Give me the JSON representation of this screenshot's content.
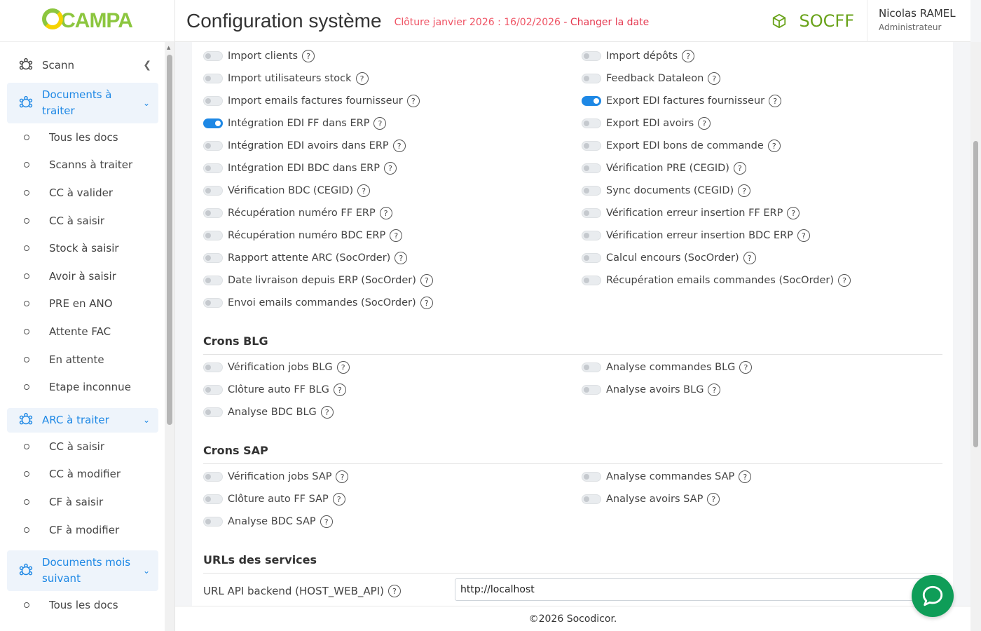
{
  "logo_text": "CAMPA",
  "sidebar": {
    "top_item": "Scann",
    "sections": [
      {
        "label": "Documents à traiter",
        "items": [
          "Tous les docs",
          "Scanns à traiter",
          "CC à valider",
          "CC à saisir",
          "Stock à saisir",
          "Avoir à saisir",
          "PRE en ANO",
          "Attente FAC",
          "En attente",
          "Etape inconnue"
        ]
      },
      {
        "label": "ARC à traiter",
        "items": [
          "CC à saisir",
          "CC à modifier",
          "CF à saisir",
          "CF à modifier"
        ]
      },
      {
        "label": "Documents mois suivant",
        "items": [
          "Tous les docs"
        ]
      }
    ]
  },
  "header": {
    "title": "Configuration système",
    "closure_text": "Clôture janvier 2026 : 16/02/2026",
    "closure_sep": " - ",
    "closure_link": "Changer la date",
    "company": "SOCFF",
    "user_name": "Nicolas RAMEL",
    "user_role": "Administrateur"
  },
  "crons_general": {
    "left": [
      {
        "label": "Import clients",
        "on": false
      },
      {
        "label": "Import utilisateurs stock",
        "on": false
      },
      {
        "label": "Import emails factures fournisseur",
        "on": false
      },
      {
        "label": "Intégration EDI FF dans ERP",
        "on": true
      },
      {
        "label": "Intégration EDI avoirs dans ERP",
        "on": false
      },
      {
        "label": "Intégration EDI BDC dans ERP",
        "on": false
      },
      {
        "label": "Vérification BDC (CEGID)",
        "on": false
      },
      {
        "label": "Récupération numéro FF ERP",
        "on": false
      },
      {
        "label": "Récupération numéro BDC ERP",
        "on": false
      },
      {
        "label": "Rapport attente ARC (SocOrder)",
        "on": false
      },
      {
        "label": "Date livraison depuis ERP (SocOrder)",
        "on": false
      },
      {
        "label": "Envoi emails commandes (SocOrder)",
        "on": false
      }
    ],
    "right": [
      {
        "label": "Import dépôts",
        "on": false
      },
      {
        "label": "Feedback Dataleon",
        "on": false
      },
      {
        "label": "Export EDI factures fournisseur",
        "on": true
      },
      {
        "label": "Export EDI avoirs",
        "on": false
      },
      {
        "label": "Export EDI bons de commande",
        "on": false
      },
      {
        "label": "Vérification PRE (CEGID)",
        "on": false
      },
      {
        "label": "Sync documents (CEGID)",
        "on": false
      },
      {
        "label": "Vérification erreur insertion FF ERP",
        "on": false
      },
      {
        "label": "Vérification erreur insertion BDC ERP",
        "on": false
      },
      {
        "label": "Calcul encours (SocOrder)",
        "on": false
      },
      {
        "label": "Récupération emails commandes (SocOrder)",
        "on": false
      }
    ]
  },
  "crons_blg": {
    "title": "Crons BLG",
    "left": [
      {
        "label": "Vérification jobs BLG",
        "on": false
      },
      {
        "label": "Clôture auto FF BLG",
        "on": false
      },
      {
        "label": "Analyse BDC BLG",
        "on": false
      }
    ],
    "right": [
      {
        "label": "Analyse commandes BLG",
        "on": false
      },
      {
        "label": "Analyse avoirs BLG",
        "on": false
      }
    ]
  },
  "crons_sap": {
    "title": "Crons SAP",
    "left": [
      {
        "label": "Vérification jobs SAP",
        "on": false
      },
      {
        "label": "Clôture auto FF SAP",
        "on": false
      },
      {
        "label": "Analyse BDC SAP",
        "on": false
      }
    ],
    "right": [
      {
        "label": "Analyse commandes SAP",
        "on": false
      },
      {
        "label": "Analyse avoirs SAP",
        "on": false
      }
    ]
  },
  "urls": {
    "title": "URLs des services",
    "api_label": "URL API backend (HOST_WEB_API)",
    "api_value": "http://localhost"
  },
  "help_glyph": "?",
  "footer": "©2026 Socodicor.",
  "colors": {
    "accent": "#1e88e5",
    "company": "#6aa31b",
    "closure": "#ef5364",
    "chat": "#0f9d58"
  }
}
